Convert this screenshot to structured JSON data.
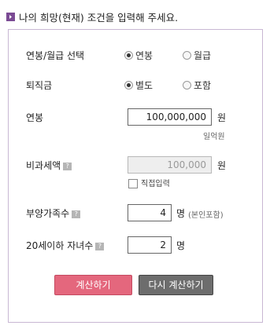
{
  "header": {
    "title": "나의 희망(현재) 조건을 입력해 주세요.",
    "icon": "chevron-right-icon"
  },
  "form": {
    "salary_type": {
      "label": "연봉/월급 선택",
      "options": [
        {
          "label": "연봉",
          "checked": true
        },
        {
          "label": "월급",
          "checked": false
        }
      ]
    },
    "severance": {
      "label": "퇴직금",
      "options": [
        {
          "label": "별도",
          "checked": true
        },
        {
          "label": "포함",
          "checked": false
        }
      ]
    },
    "salary": {
      "label": "연봉",
      "value": "100,000,000",
      "unit": "원",
      "hangul": "일억원"
    },
    "nontaxable": {
      "label": "비과세액",
      "value": "100,000",
      "unit": "원",
      "direct_input_label": "직접입력"
    },
    "dependents": {
      "label": "부양가족수",
      "value": "4",
      "unit": "명",
      "note": "(본인포함)"
    },
    "children": {
      "label": "20세이하 자녀수",
      "value": "2",
      "unit": "명"
    }
  },
  "buttons": {
    "calculate": "계산하기",
    "reset": "다시 계산하기"
  },
  "colors": {
    "accent": "#7b4b94",
    "calc_button": "#e4677d",
    "reset_button": "#6d6d6d"
  }
}
